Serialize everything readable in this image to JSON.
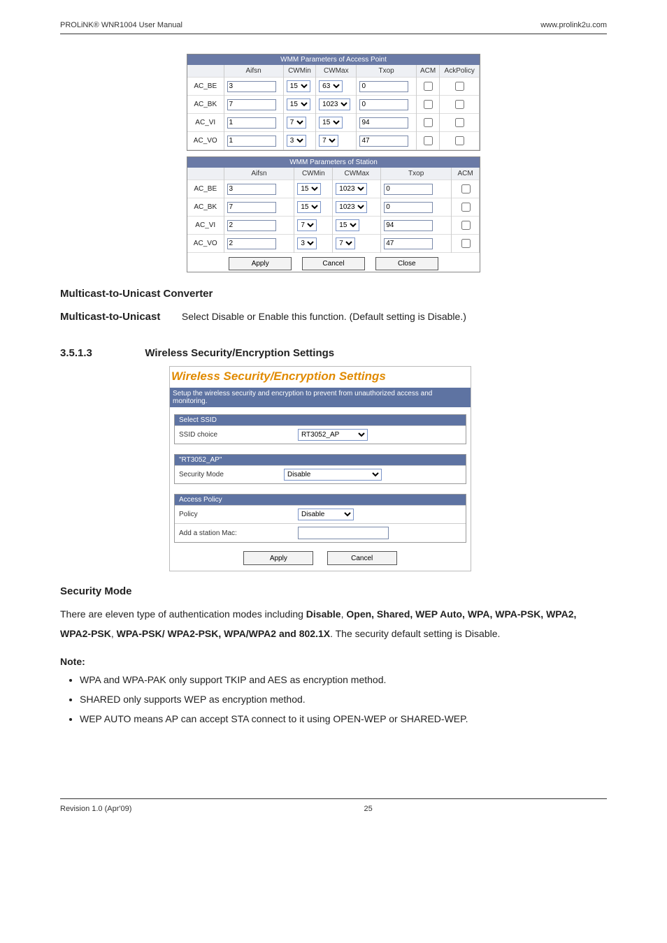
{
  "header": {
    "left": "PROLiNK® WNR1004 User Manual",
    "right": "www.prolink2u.com"
  },
  "footer": {
    "rev": "Revision 1.0 (Apr'09)",
    "page": "25"
  },
  "wmm_ap": {
    "title": "WMM Parameters of Access Point",
    "cols": [
      "Aifsn",
      "CWMin",
      "CWMax",
      "Txop",
      "ACM",
      "AckPolicy"
    ],
    "rows": [
      {
        "name": "AC_BE",
        "aifsn": "3",
        "cwmin": "15",
        "cwmax": "63",
        "txop": "0",
        "acm": false,
        "ack": false
      },
      {
        "name": "AC_BK",
        "aifsn": "7",
        "cwmin": "15",
        "cwmax": "1023",
        "txop": "0",
        "acm": false,
        "ack": false
      },
      {
        "name": "AC_VI",
        "aifsn": "1",
        "cwmin": "7",
        "cwmax": "15",
        "txop": "94",
        "acm": false,
        "ack": false
      },
      {
        "name": "AC_VO",
        "aifsn": "1",
        "cwmin": "3",
        "cwmax": "7",
        "txop": "47",
        "acm": false,
        "ack": false
      }
    ]
  },
  "wmm_sta": {
    "title": "WMM Parameters of Station",
    "cols": [
      "Aifsn",
      "CWMin",
      "CWMax",
      "Txop",
      "ACM"
    ],
    "rows": [
      {
        "name": "AC_BE",
        "aifsn": "3",
        "cwmin": "15",
        "cwmax": "1023",
        "txop": "0",
        "acm": false
      },
      {
        "name": "AC_BK",
        "aifsn": "7",
        "cwmin": "15",
        "cwmax": "1023",
        "txop": "0",
        "acm": false
      },
      {
        "name": "AC_VI",
        "aifsn": "2",
        "cwmin": "7",
        "cwmax": "15",
        "txop": "94",
        "acm": false
      },
      {
        "name": "AC_VO",
        "aifsn": "2",
        "cwmin": "3",
        "cwmax": "7",
        "txop": "47",
        "acm": false
      }
    ],
    "buttons": {
      "apply": "Apply",
      "cancel": "Cancel",
      "close": "Close"
    }
  },
  "mcast": {
    "heading": "Multicast-to-Unicast Converter",
    "term": "Multicast-to-Unicast",
    "desc": "Select Disable or Enable this function. (Default setting is Disable.)"
  },
  "section": {
    "num": "3.5.1.3",
    "title": "Wireless Security/Encryption Settings"
  },
  "wsec": {
    "banner": "Wireless Security/Encryption Settings",
    "sub": "Setup the wireless security and encryption to prevent from unauthorized access and monitoring.",
    "select_ssid_h": "Select SSID",
    "ssid_label": "SSID choice",
    "ssid_value": "RT3052_AP",
    "ssid_block_h": "\"RT3052_AP\"",
    "secmode_label": "Security Mode",
    "secmode_value": "Disable",
    "access_h": "Access Policy",
    "policy_label": "Policy",
    "policy_value": "Disable",
    "mac_label": "Add a station Mac:",
    "mac_value": "",
    "buttons": {
      "apply": "Apply",
      "cancel": "Cancel"
    }
  },
  "secmode_h": "Security Mode",
  "secmode_p_pre": "There are eleven type of authentication modes including ",
  "secmode_p_b1": "Disable",
  "secmode_p_m1": ", ",
  "secmode_p_b2": "Open, Shared, WEP Auto, WPA, WPA-PSK, WPA2, WPA2-PSK",
  "secmode_p_m2": ", ",
  "secmode_p_b3": "WPA-PSK/ WPA2-PSK, WPA/WPA2 and 802.1X",
  "secmode_p_post": ". The security default setting is Disable.",
  "note_h": "Note:",
  "notes": [
    "WPA and WPA-PAK only support TKIP and AES as encryption method.",
    "SHARED only supports WEP as encryption method.",
    "WEP AUTO means AP can accept STA connect to it using OPEN-WEP or SHARED-WEP."
  ]
}
